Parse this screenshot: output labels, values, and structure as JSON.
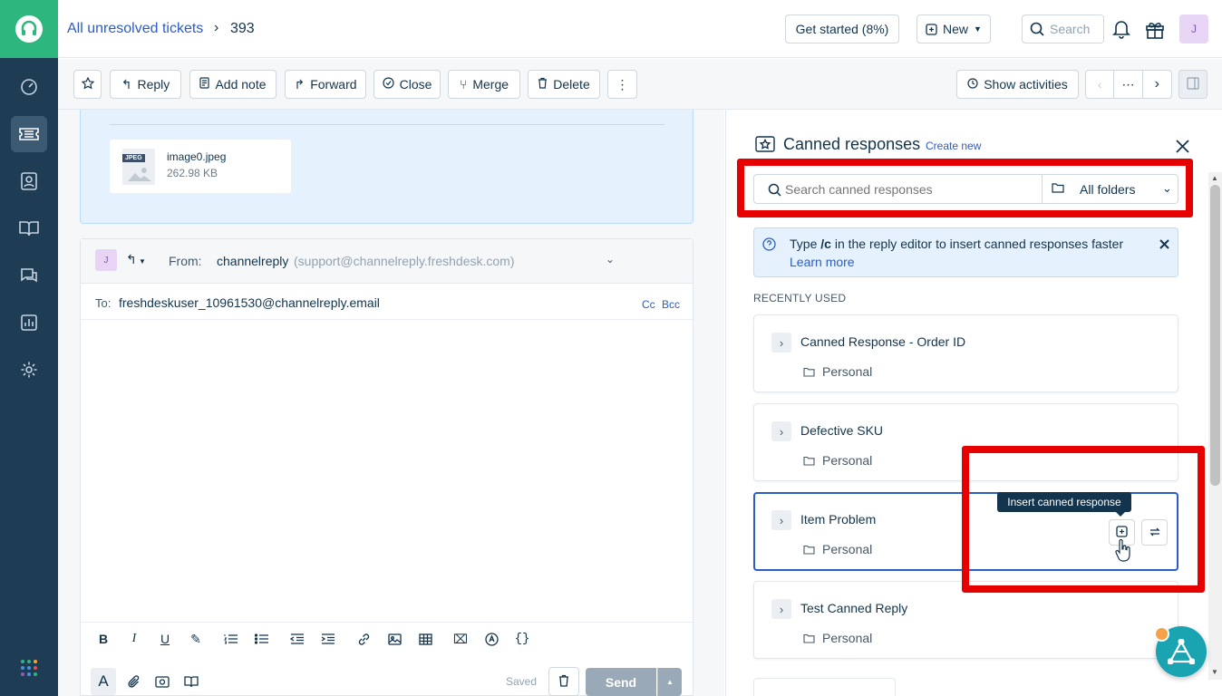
{
  "header": {
    "breadcrumb_link": "All unresolved tickets",
    "ticket_id": "393",
    "get_started": "Get started (8%)",
    "new_label": "New",
    "search_label": "Search",
    "avatar": "J"
  },
  "toolbar": {
    "reply": "Reply",
    "add_note": "Add note",
    "forward": "Forward",
    "close": "Close",
    "merge": "Merge",
    "delete": "Delete",
    "more": "⋮",
    "show_activities": "Show activities",
    "ellipsis": "⋯"
  },
  "attachment": {
    "badge": "JPEG",
    "name": "image0.jpeg",
    "size": "262.98 KB"
  },
  "reply": {
    "avatar": "J",
    "from_label": "From:",
    "from_name": "channelreply",
    "from_email": "(support@channelreply.freshdesk.com)",
    "to_label": "To:",
    "to_value": "freshdeskuser_10961530@channelreply.email",
    "cc": "Cc",
    "bcc": "Bcc",
    "saved": "Saved",
    "send": "Send"
  },
  "canned": {
    "title": "Canned responses",
    "create_new": "Create new",
    "search_placeholder": "Search canned responses",
    "folder_select": "All folders",
    "tip_prefix": "Type ",
    "tip_code": "/c",
    "tip_suffix": " in the reply editor to insert canned responses faster",
    "learn_more": "Learn more",
    "section_label": "RECENTLY USED",
    "tooltip": "Insert canned response",
    "items": [
      {
        "title": "Canned Response - Order ID",
        "folder": "Personal"
      },
      {
        "title": "Defective SKU",
        "folder": "Personal"
      },
      {
        "title": "Item Problem",
        "folder": "Personal"
      },
      {
        "title": "Test Canned Reply",
        "folder": "Personal"
      }
    ]
  },
  "colors": {
    "sidebar": "#1f3c55",
    "brand_green": "#2db67d",
    "link_blue": "#2c5cc5",
    "highlight_red": "#e60000",
    "tooltip_bg": "#12344d",
    "chat_widget": "#1aa3b0"
  }
}
